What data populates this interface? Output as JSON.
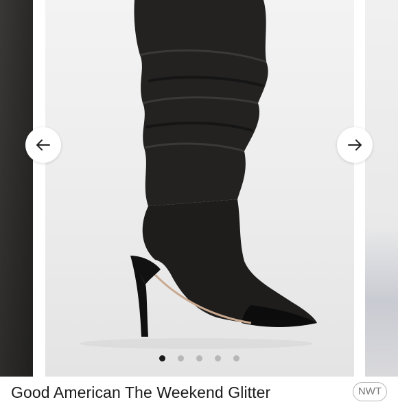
{
  "carousel": {
    "prev_label": "Previous image",
    "next_label": "Next image",
    "dot_count": 5,
    "active_index": 0,
    "colors": {
      "active_dot": "#1a1a1a",
      "inactive_dot": "#b7b7b7"
    },
    "icons": {
      "prev": "arrow-left-icon",
      "next": "arrow-right-icon"
    }
  },
  "listing": {
    "title": "Good American The Weekend Glitter",
    "condition_badge": "NWT"
  }
}
